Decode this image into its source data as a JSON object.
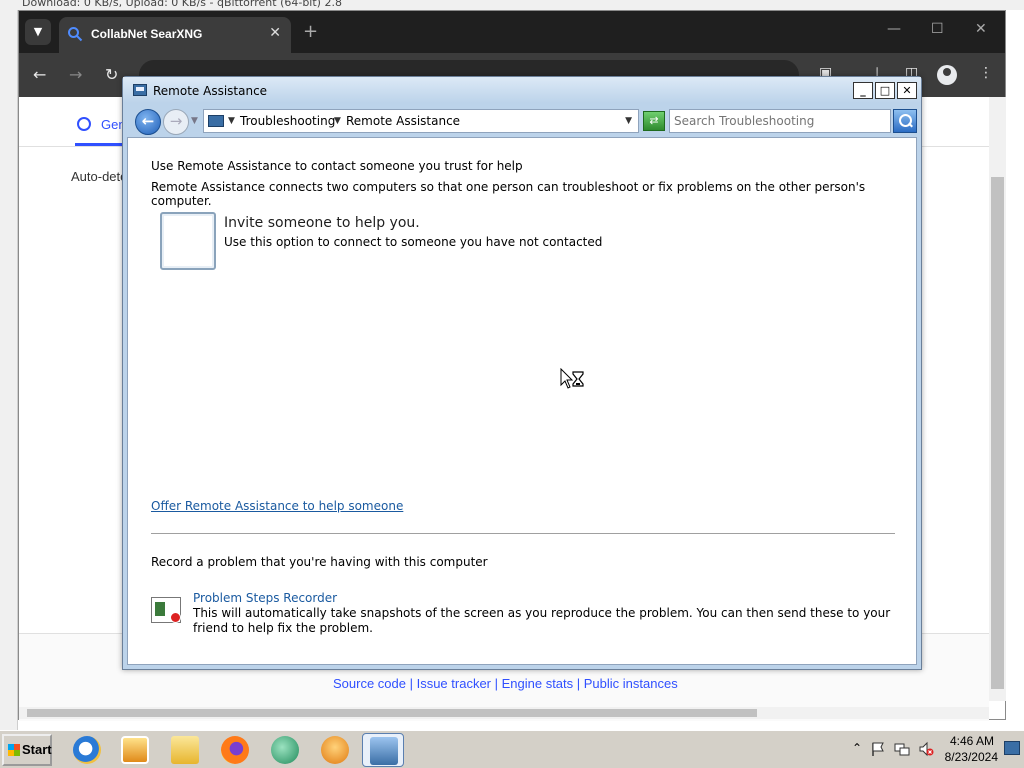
{
  "background_app": {
    "title": "Download: 0 KB/s, Upload: 0 KB/s - qBittorrent (64-bit) 2.8"
  },
  "chrome": {
    "tab_title": "CollabNet SearXNG",
    "page_tab_general": "Gen",
    "auto_detect_text": "Auto-dete",
    "footer_links": "Source code | Issue tracker | Engine stats | Public instances"
  },
  "remote_assistance": {
    "window_title": "Remote Assistance",
    "breadcrumb": [
      "Troubleshooting",
      "Remote Assistance"
    ],
    "search_placeholder": "Search Troubleshooting",
    "heading": "Use Remote Assistance to contact someone you trust for help",
    "description": "Remote Assistance connects two computers so that one person can troubleshoot or fix problems on the other person's computer.",
    "invite": {
      "title": "Invite someone to help you.",
      "subtitle": "Use this option to connect to someone you have not contacted"
    },
    "offer_link": "Offer Remote Assistance to help someone",
    "record_heading": "Record a problem that you're having with this computer",
    "psr": {
      "title": "Problem Steps Recorder",
      "description": "This will automatically take snapshots of the screen as you reproduce the problem. You can then send these to your friend to help fix the problem."
    }
  },
  "taskbar": {
    "start_label": "Start",
    "apps": [
      "internet-explorer-icon",
      "media-player-icon",
      "file-explorer-icon",
      "firefox-icon",
      "chat-app-icon",
      "vlc-icon",
      "remote-assistance-icon"
    ],
    "time": "4:46 AM",
    "date": "8/23/2024"
  },
  "colors": {
    "titlebar": "#bcd3ea",
    "link": "#1a5aa0",
    "taskbar": "#d4d0c8"
  }
}
